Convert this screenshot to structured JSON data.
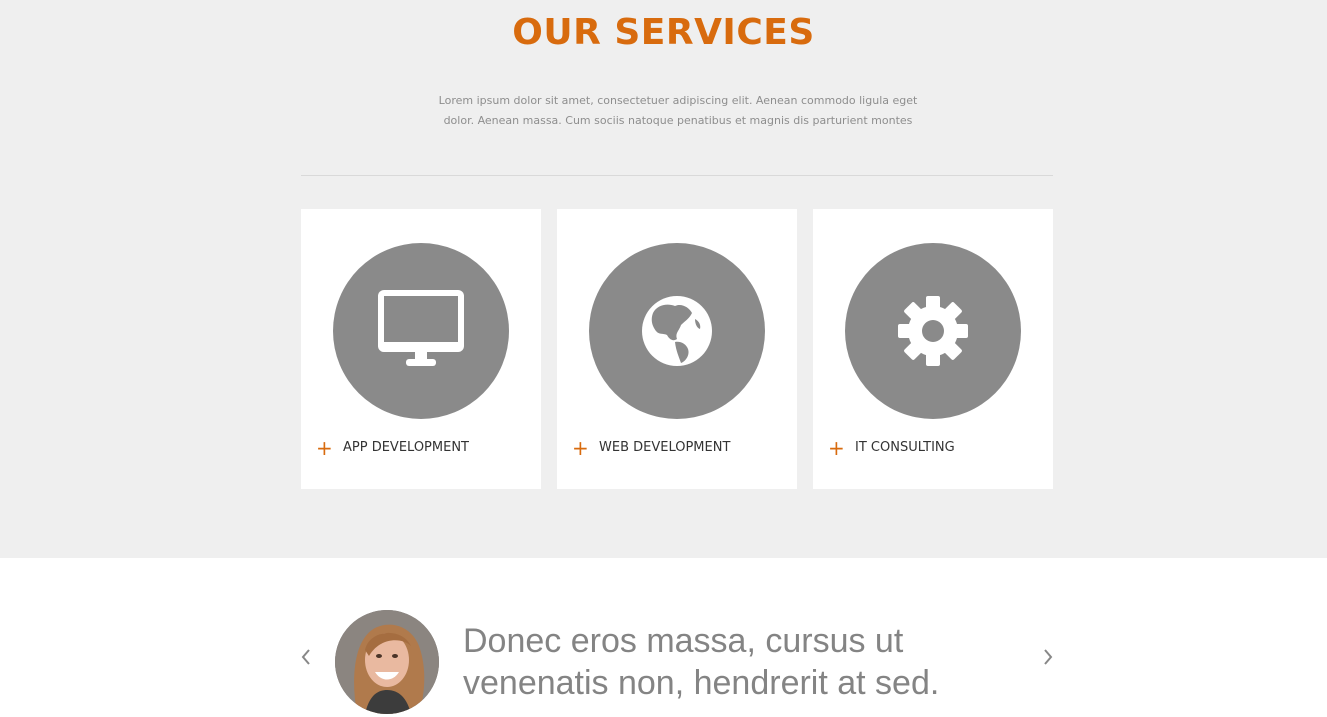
{
  "services": {
    "title": "OUR SERVICES",
    "description": "Lorem ipsum dolor sit amet, consectetuer adipiscing elit. Aenean commodo ligula eget dolor. Aenean massa. Cum sociis natoque penatibus et magnis dis parturient montes",
    "items": [
      {
        "label": "APP DEVELOPMENT",
        "icon": "monitor-icon"
      },
      {
        "label": "WEB DEVELOPMENT",
        "icon": "globe-icon"
      },
      {
        "label": "IT CONSULTING",
        "icon": "gear-icon"
      }
    ],
    "plus_symbol": "+",
    "colors": {
      "accent": "#d86b0e",
      "icon_circle": "#8a8a8a",
      "background": "#efefef"
    }
  },
  "testimonial": {
    "quote": "Donec eros massa, cursus ut venenatis non, hendrerit at sed."
  }
}
